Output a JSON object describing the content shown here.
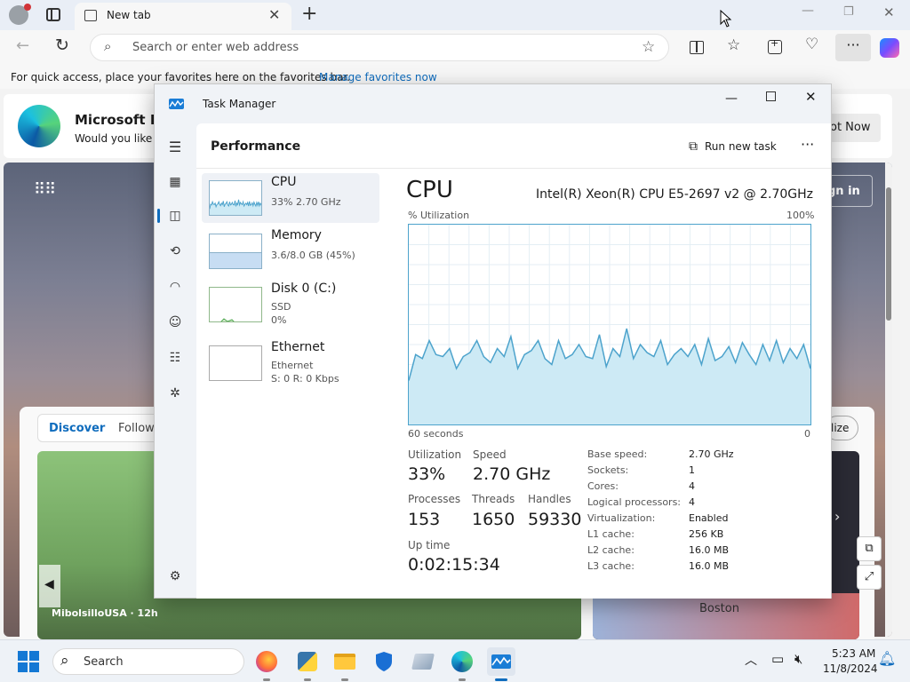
{
  "browser": {
    "tab_title": "New tab",
    "address_placeholder": "Search or enter web address",
    "fav_text": "For quick access, place your favorites here on the favorites bar.",
    "fav_link": "Manage favorites now",
    "promo_title": "Microsoft Edg",
    "promo_sub": "Would you like t",
    "promo_button": "ot Now",
    "signin": "gn in",
    "feed_tabs": [
      "Discover",
      "Follow"
    ],
    "personalize": "lize",
    "card_source": "MibolsilloUSA · 12h",
    "map_label": "Boston",
    "accent": "#0f6cbd"
  },
  "taskmanager": {
    "title": "Task Manager",
    "page_title": "Performance",
    "run_new_task": "Run new task",
    "more": "···",
    "items": [
      {
        "title": "CPU",
        "sub1": "33% 2.70 GHz",
        "sub2": "",
        "sub3": ""
      },
      {
        "title": "Memory",
        "sub1": "3.6/8.0 GB (45%)",
        "sub2": "",
        "sub3": ""
      },
      {
        "title": "Disk 0 (C:)",
        "sub1": "SSD",
        "sub2": "0%",
        "sub3": ""
      },
      {
        "title": "Ethernet",
        "sub1": "Ethernet",
        "sub2": "S: 0 R: 0 Kbps",
        "sub3": ""
      }
    ],
    "heading": "CPU",
    "model": "Intel(R) Xeon(R) CPU E5-2697 v2 @ 2.70GHz",
    "util_label": "% Utilization",
    "util_max": "100%",
    "x_left": "60 seconds",
    "x_right": "0",
    "stats": {
      "utilization_label": "Utilization",
      "utilization": "33%",
      "speed_label": "Speed",
      "speed": "2.70 GHz",
      "processes_label": "Processes",
      "processes": "153",
      "threads_label": "Threads",
      "threads": "1650",
      "handles_label": "Handles",
      "handles": "59330",
      "uptime_label": "Up time",
      "uptime": "0:02:15:34"
    },
    "specs": [
      {
        "label": "Base speed:",
        "value": "2.70 GHz"
      },
      {
        "label": "Sockets:",
        "value": "1"
      },
      {
        "label": "Cores:",
        "value": "4"
      },
      {
        "label": "Logical processors:",
        "value": "4"
      },
      {
        "label": "Virtualization:",
        "value": "Enabled"
      },
      {
        "label": "L1 cache:",
        "value": "256 KB"
      },
      {
        "label": "L2 cache:",
        "value": "16.0 MB"
      },
      {
        "label": "L3 cache:",
        "value": "16.0 MB"
      }
    ],
    "cpu_history": [
      22,
      35,
      33,
      42,
      35,
      34,
      38,
      28,
      34,
      36,
      42,
      34,
      31,
      38,
      34,
      44,
      28,
      35,
      37,
      42,
      33,
      30,
      42,
      33,
      35,
      40,
      34,
      33,
      45,
      29,
      38,
      34,
      48,
      33,
      40,
      36,
      34,
      42,
      30,
      35,
      38,
      34,
      40,
      30,
      43,
      32,
      34,
      39,
      31,
      41,
      35,
      30,
      40,
      32,
      42,
      31,
      38,
      33,
      40,
      28
    ],
    "graph_color": "#4da3cc",
    "graph_fill": "#cdeaf5"
  },
  "taskbar": {
    "search": "Search",
    "time": "5:23 AM",
    "date": "11/8/2024"
  }
}
